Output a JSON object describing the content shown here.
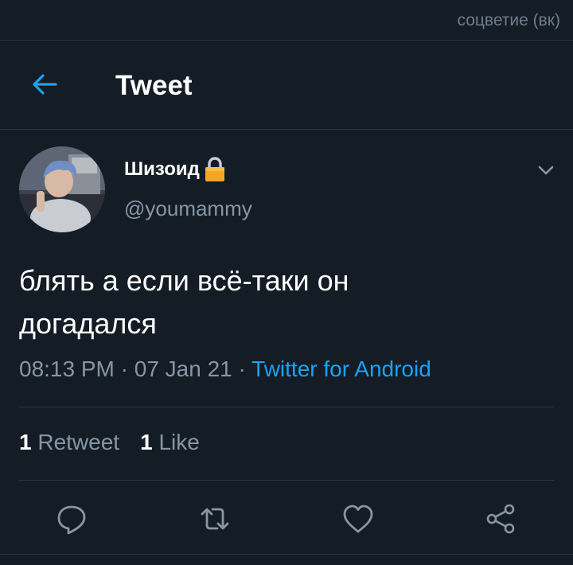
{
  "watermark": "соцветие (вк)",
  "header": {
    "title": "Tweet",
    "back_icon": "arrow-left-icon"
  },
  "user": {
    "display_name": "Шизоид",
    "handle": "@youmammy",
    "lock_icon": "lock-icon",
    "avatar": "avatar"
  },
  "tweet": {
    "text_line1": "блять а если всё-таки он",
    "text_line2": "догадался",
    "time": "08:13 PM",
    "date": "07 Jan 21",
    "separator": " · ",
    "source": "Twitter for Android"
  },
  "stats": {
    "retweets_count": "1",
    "retweets_label": "Retweet",
    "likes_count": "1",
    "likes_label": "Like"
  },
  "actions": [
    "reply-icon",
    "retweet-icon",
    "like-icon",
    "share-icon"
  ],
  "colors": {
    "background": "#141d26",
    "accent": "#1da1f2",
    "muted": "#8796a5",
    "divider": "#2a3541",
    "lock": "#f5a623"
  }
}
